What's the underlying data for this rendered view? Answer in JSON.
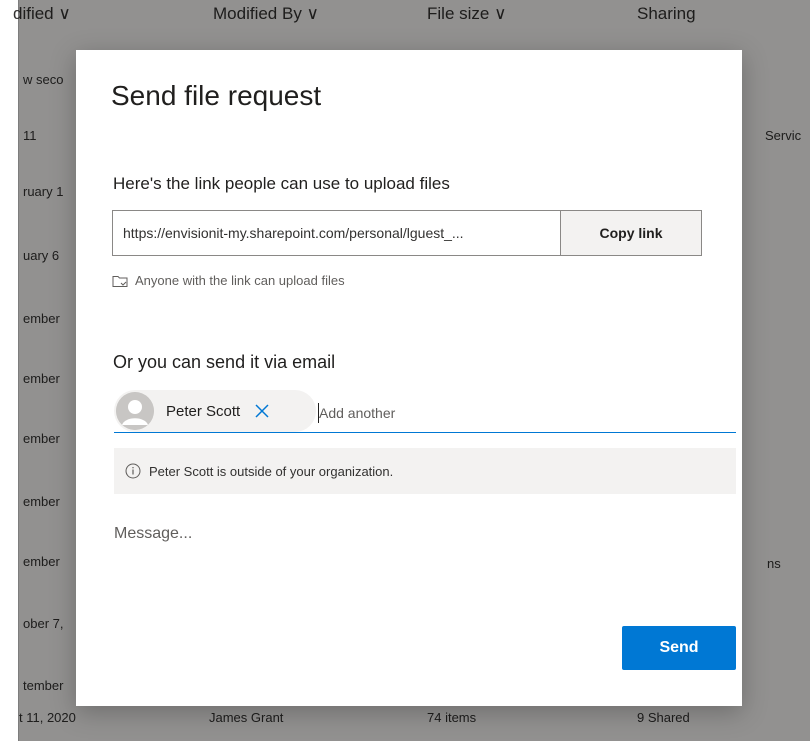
{
  "background": {
    "header": {
      "col_modified": "dified ∨",
      "col_modified_by": "Modified By ∨",
      "col_file_size": "File size ∨",
      "col_sharing": "Sharing"
    },
    "rows": [
      "w seco",
      "11",
      "ruary 1",
      "uary 6",
      "ember",
      "ember",
      "ember",
      "ember",
      "ember",
      "ober 7,",
      "tember"
    ],
    "right_texts": {
      "servic": "Servic",
      "ns": "ns"
    },
    "bottom_row": {
      "date": "t 11, 2020",
      "name": "James Grant",
      "size": "74 items",
      "sharing": "9 Shared"
    }
  },
  "dialog": {
    "title": "Send file request",
    "link_label": "Here's the link people can use to upload files",
    "link_value": "https://envisionit-my.sharepoint.com/personal/lguest_...",
    "copy_label": "Copy link",
    "upload_note": "Anyone with the link can upload files",
    "email_label": "Or you can send it via email",
    "recipient": {
      "name": "Peter Scott"
    },
    "add_placeholder": "Add another",
    "info_text": "Peter Scott is outside of your organization.",
    "message_placeholder": "Message...",
    "send_label": "Send"
  },
  "colors": {
    "accent": "#0078d4",
    "overlay": "rgba(0,0,0,0.40)",
    "chip_bg": "#f3f2f1"
  },
  "icons": [
    "folder-link-icon",
    "avatar-icon",
    "close-icon",
    "info-icon"
  ]
}
